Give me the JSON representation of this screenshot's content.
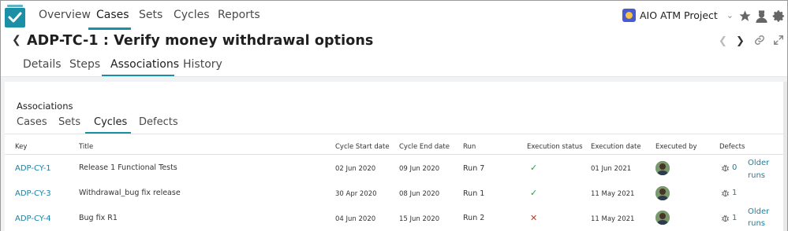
{
  "topnav": {
    "items": [
      {
        "label": "Overview"
      },
      {
        "label": "Cases"
      },
      {
        "label": "Sets"
      },
      {
        "label": "Cycles"
      },
      {
        "label": "Reports"
      }
    ],
    "project": "AIO ATM Project"
  },
  "title": "ADP-TC-1 : Verify money withdrawal options",
  "main_tabs": [
    {
      "label": "Details"
    },
    {
      "label": "Steps"
    },
    {
      "label": "Associations"
    },
    {
      "label": "History"
    }
  ],
  "associations": {
    "heading": "Associations",
    "tabs": [
      {
        "label": "Cases"
      },
      {
        "label": "Sets"
      },
      {
        "label": "Cycles"
      },
      {
        "label": "Defects"
      }
    ]
  },
  "table": {
    "headers": {
      "key": "Key",
      "title": "Title",
      "start": "Cycle Start date",
      "end": "Cycle End date",
      "run": "Run",
      "status": "Execution status",
      "exec_date": "Execution date",
      "executed_by": "Executed by",
      "defects": "Defects"
    },
    "rows": [
      {
        "key": "ADP-CY-1",
        "title": "Release 1 Functional Tests",
        "start": "02 Jun 2020",
        "end": "09 Jun 2020",
        "run": "Run 7",
        "status": "pass",
        "exec_date": "01 Jun 2021",
        "defects": "0",
        "older1": "Older",
        "older2": "runs"
      },
      {
        "key": "ADP-CY-3",
        "title": "Withdrawal_bug fix release",
        "start": "30 Apr 2020",
        "end": "08 Jun 2020",
        "run": "Run 1",
        "status": "pass",
        "exec_date": "11 May 2021",
        "defects": "1",
        "older1": "",
        "older2": ""
      },
      {
        "key": "ADP-CY-4",
        "title": "Bug fix R1",
        "start": "04 Jun 2020",
        "end": "15 Jun 2020",
        "run": "Run 2",
        "status": "fail",
        "exec_date": "11 May 2021",
        "defects": "1",
        "older1": "Older",
        "older2": "runs"
      }
    ]
  }
}
